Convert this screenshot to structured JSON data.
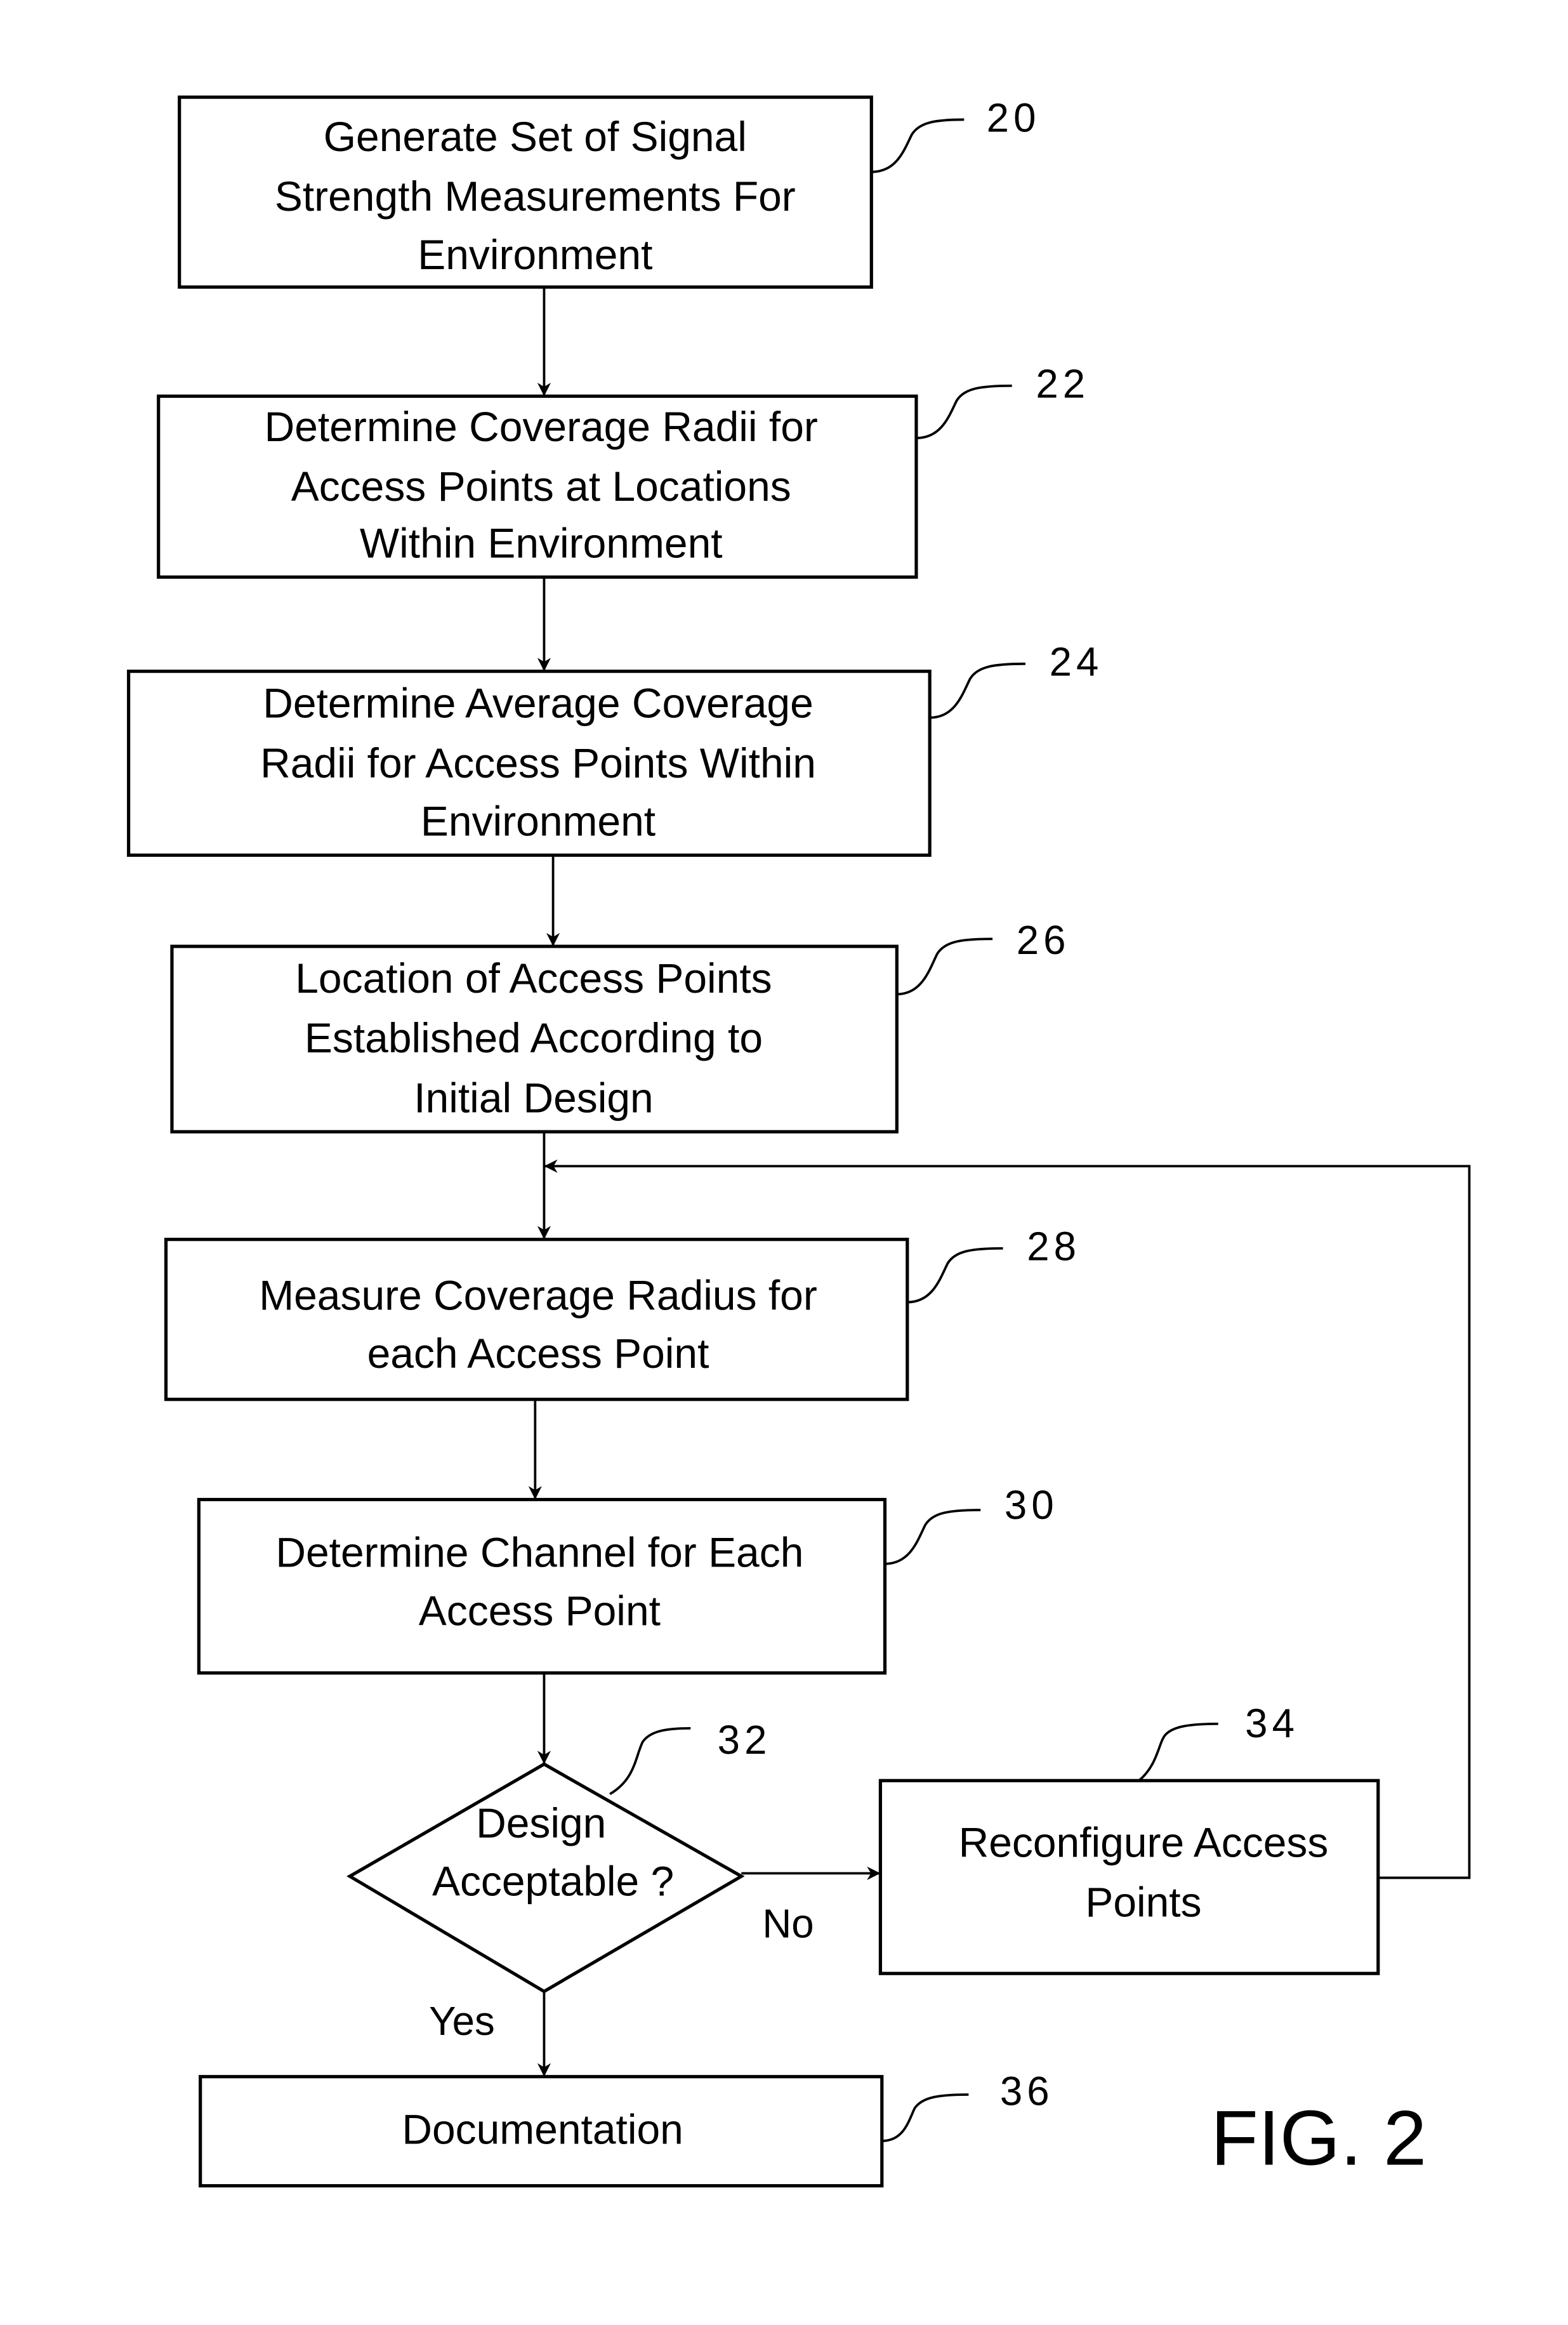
{
  "figure": {
    "title": "FIG. 2",
    "steps": [
      {
        "ref": "20",
        "lines": [
          "Generate Set of Signal",
          "Strength Measurements For",
          "Environment"
        ]
      },
      {
        "ref": "22",
        "lines": [
          "Determine Coverage Radii for",
          "Access Points at Locations",
          "Within Environment"
        ]
      },
      {
        "ref": "24",
        "lines": [
          "Determine Average Coverage",
          "Radii for Access Points Within",
          "Environment"
        ]
      },
      {
        "ref": "26",
        "lines": [
          "Location of Access Points",
          "Established According to",
          "Initial Design"
        ]
      },
      {
        "ref": "28",
        "lines": [
          "Measure Coverage Radius for",
          "each Access Point"
        ]
      },
      {
        "ref": "30",
        "lines": [
          "Determine Channel for Each",
          "Access Point"
        ]
      },
      {
        "ref": "32",
        "lines": [
          "Design",
          "Acceptable ?"
        ]
      },
      {
        "ref": "34",
        "lines": [
          "Reconfigure Access",
          "Points"
        ]
      },
      {
        "ref": "36",
        "lines": [
          "Documentation"
        ]
      }
    ],
    "edges": {
      "no_label": "No",
      "yes_label": "Yes"
    }
  }
}
